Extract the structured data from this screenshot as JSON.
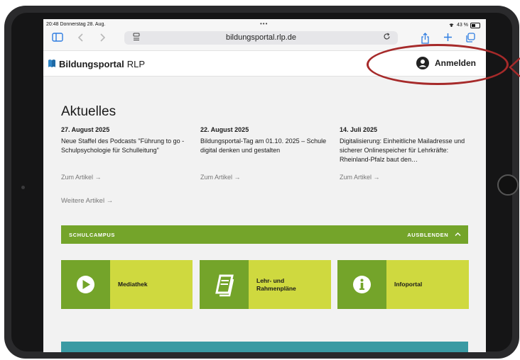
{
  "status_bar": {
    "time": "20:48  Donnerstag 28. Aug.",
    "battery": "43 %"
  },
  "browser": {
    "url": "bildungsportal.rlp.de"
  },
  "header": {
    "logo_bold": "Bildungsportal",
    "logo_light": "RLP",
    "login_label": "Anmelden"
  },
  "news_section": {
    "title": "Aktuelles",
    "items": [
      {
        "date": "27. August 2025",
        "text": "Neue Staffel des Podcasts \"Führung to go - Schulpsychologie für Schulleitung\"",
        "link": "Zum Artikel →"
      },
      {
        "date": "22. August 2025",
        "text": "Bildungsportal-Tag am 01.10. 2025 – Schule digital denken und gestalten",
        "link": "Zum Artikel →"
      },
      {
        "date": "14. Juli 2025",
        "text": "Digitalisierung: Einheitliche Mailadresse und sicherer Onlinespeicher für Lehrkräfte: Rheinland-Pfalz baut den…",
        "link": "Zum Artikel →"
      }
    ],
    "more_link": "Weitere Artikel →"
  },
  "schulcampus": {
    "title": "SCHULCAMPUS",
    "toggle": "AUSBLENDEN",
    "tiles": [
      {
        "label": "Mediathek",
        "icon": "play-icon"
      },
      {
        "label": "Lehr- und Rahmenpläne",
        "icon": "book-icon"
      },
      {
        "label": "Infoportal",
        "icon": "info-icon"
      }
    ]
  },
  "colors": {
    "brand_green": "#74a42a",
    "tile_yellow": "#cfd93f",
    "teal": "#3a9aa3",
    "annotation_red": "#a62a2a"
  }
}
